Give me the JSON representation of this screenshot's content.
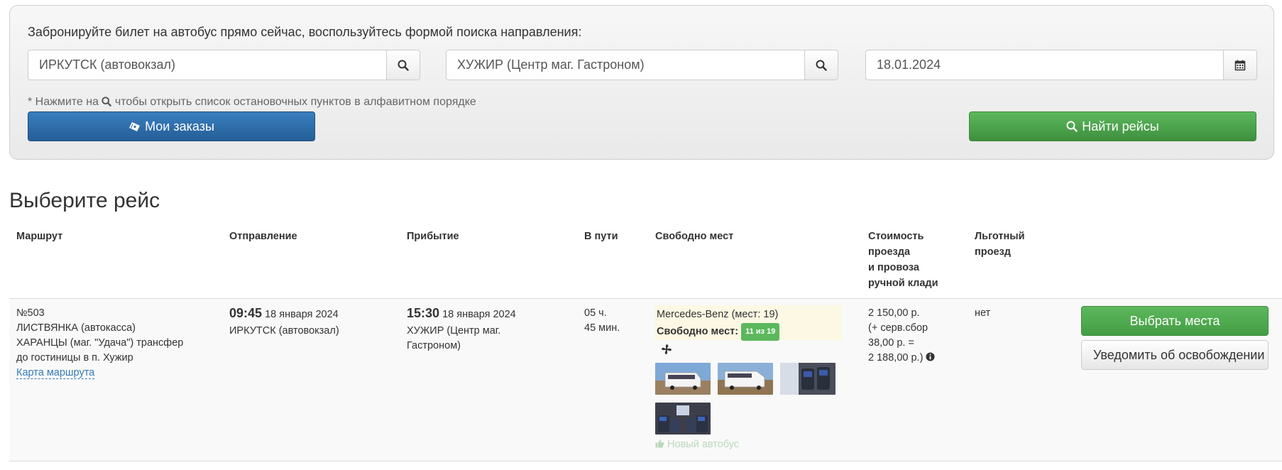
{
  "search": {
    "intro": "Забронируйте билет на автобус прямо сейчас, воспользуйтесь формой поиска направления:",
    "from_value": "ИРКУТСК (автовокзал)",
    "to_value": "ХУЖИР (Центр маг. Гастроном)",
    "date_value": "18.01.2024",
    "hint_prefix": "* Нажмите на",
    "hint_suffix": "чтобы открыть список остановочных пунктов в алфавитном порядке",
    "my_orders_label": "Мои заказы",
    "find_label": "Найти рейсы"
  },
  "results": {
    "title": "Выберите рейс",
    "headers": {
      "route": "Маршрут",
      "departure": "Отправление",
      "arrival": "Прибытие",
      "duration": "В пути",
      "seats": "Свободно мест",
      "price_l1": "Стоимость",
      "price_l2": "проезда",
      "price_l3": "и провоза",
      "price_l4": "ручной клади",
      "benefit_l1": "Льготный",
      "benefit_l2": "проезд"
    },
    "trips": [
      {
        "route_number": "№503",
        "route_l1": "ЛИСТВЯНКА (автокасса)",
        "route_l2": "ХАРАНЦЫ (маг. \"Удача\") трансфер",
        "route_l3": "до гостиницы в п. Хужир",
        "map_link": "Карта маршрута",
        "dep_time": "09:45",
        "dep_date": "18 января 2024",
        "dep_place": "ИРКУТСК (автовокзал)",
        "arr_time": "15:30",
        "arr_date": "18 января 2024",
        "arr_place_l1": "ХУЖИР (Центр маг.",
        "arr_place_l2": "Гастроном)",
        "duration_l1": "05 ч.",
        "duration_l2": "45 мин.",
        "bus": "Mercedes-Benz (мест: 19)",
        "free_label": "Свободно мест:",
        "free_badge": "11 из 19",
        "price_l1": "2 150,00 р.",
        "price_l2": "(+ серв.сбор",
        "price_l3": "38,00 р. =",
        "price_l4": "2 188,00 р.)",
        "benefit": "нет",
        "new_bus": "Новый автобус",
        "select_label": "Выбрать места",
        "notify_label": "Уведомить об освобождении мест"
      }
    ]
  },
  "colors": {
    "primary": "#2d6ca8",
    "success": "#4cae4c",
    "link": "#337ab7",
    "highlight": "#fcf8e3"
  },
  "icons": [
    "search-icon",
    "calendar-icon",
    "ticket-icon",
    "fan-icon",
    "info-icon",
    "thumbs-up-icon"
  ]
}
